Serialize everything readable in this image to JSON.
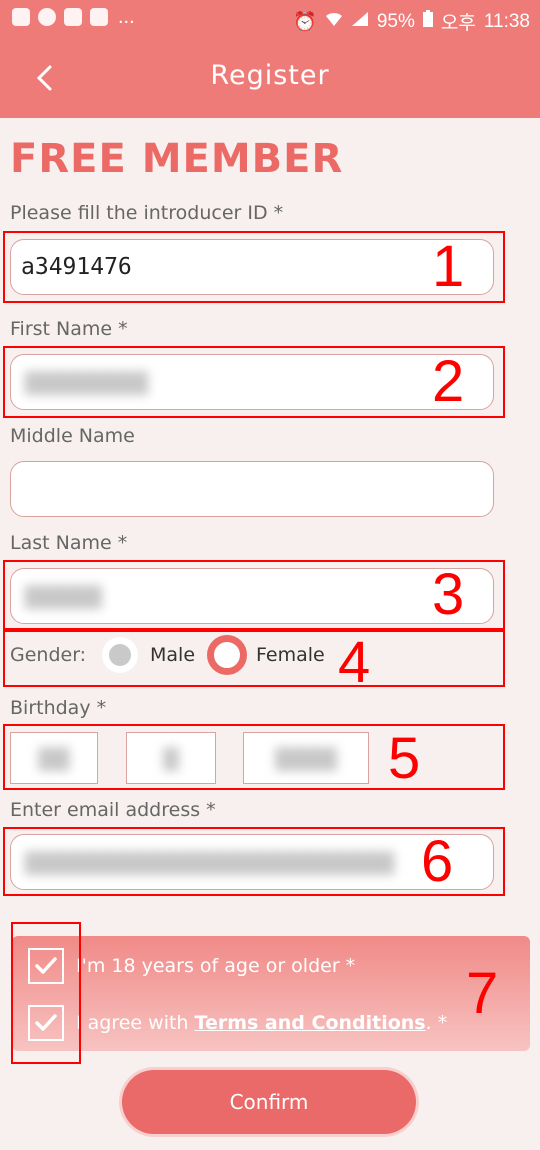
{
  "status_bar": {
    "battery": "95%",
    "ampm": "오후",
    "time": "11:38",
    "more": "..."
  },
  "header": {
    "title": "Register"
  },
  "heading": "FREE MEMBER",
  "introducer": {
    "label": "Please fill the introducer ID *",
    "value": "a3491476"
  },
  "first_name": {
    "label": "First Name *",
    "value": "████████"
  },
  "middle_name": {
    "label": "Middle Name",
    "value": ""
  },
  "last_name": {
    "label": "Last Name *",
    "value": "█████"
  },
  "gender": {
    "label": "Gender:",
    "options": [
      "Male",
      "Female"
    ],
    "selected": "Female"
  },
  "birthday": {
    "label": "Birthday *",
    "day": "██",
    "month": "█",
    "year": "████"
  },
  "email": {
    "label": "Enter email address *",
    "value": "████████████████████████"
  },
  "agree": {
    "age": "I'm 18 years of age or older *",
    "terms_prefix": "I agree with ",
    "terms_link": "Terms and Conditions",
    "terms_suffix": ". *"
  },
  "confirm_label": "Confirm",
  "annotations": [
    "1",
    "2",
    "3",
    "4",
    "5",
    "6",
    "7"
  ],
  "colors": {
    "accent": "#ef7b79",
    "heading": "#ec6a66",
    "annotation": "#ff0000"
  }
}
